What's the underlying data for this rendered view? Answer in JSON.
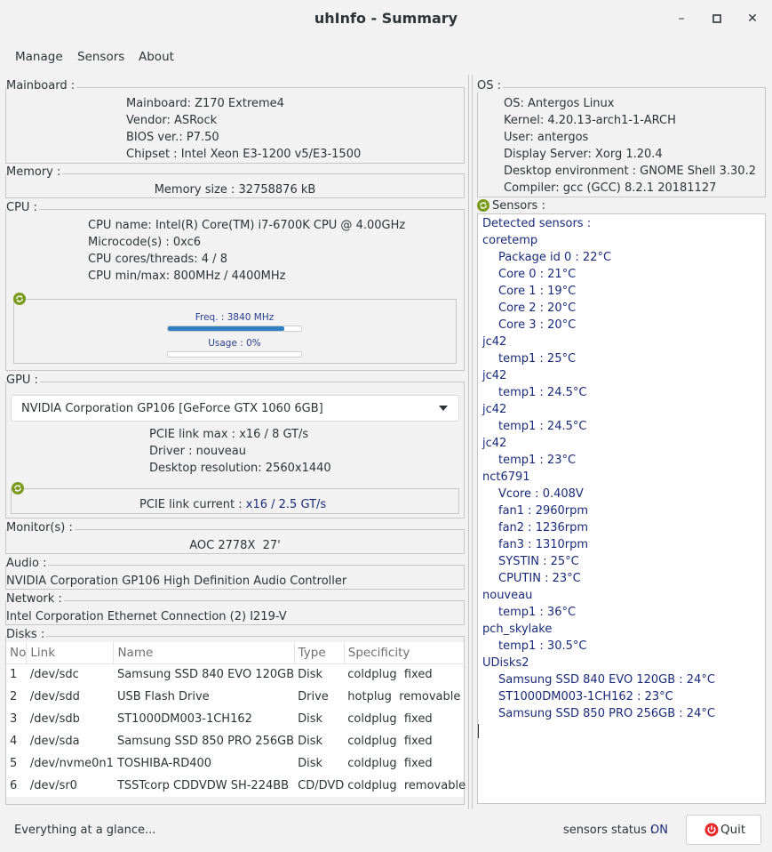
{
  "window": {
    "title": "uhInfo - Summary",
    "minimize_glyph": "–",
    "maximize_glyph": "□",
    "close_glyph": "✕"
  },
  "menu": [
    "Manage",
    "Sensors",
    "About"
  ],
  "mainboard": {
    "label": "Mainboard :",
    "lines": [
      "Mainboard: Z170 Extreme4",
      "Vendor: ASRock",
      "BIOS ver.: P7.50",
      "Chipset : Intel Xeon E3-1200 v5/E3-1500"
    ]
  },
  "memory": {
    "label": "Memory :",
    "size": "Memory size : 32758876 kB"
  },
  "cpu": {
    "label": "CPU :",
    "lines": [
      "CPU name: Intel(R) Core(TM) i7-6700K CPU @ 4.00GHz",
      "Microcode(s) : 0xc6",
      "CPU cores/threads: 4 / 8",
      "CPU min/max: 800MHz / 4400MHz"
    ],
    "freq_label": "Freq. : 3840 MHz",
    "freq_fraction": 0.8727,
    "usage_label": "Usage : 0%",
    "usage_fraction": 0
  },
  "gpu": {
    "label": "GPU :",
    "selected": "NVIDIA Corporation GP106 [GeForce GTX 1060 6GB]",
    "lines": [
      "PCIE link max : x16 / 8 GT/s",
      "Driver : nouveau",
      "Desktop resolution: 2560x1440"
    ],
    "link_current_label": "PCIE link current : ",
    "link_current_value": "x16 / 2.5 GT/s"
  },
  "monitors": {
    "label": "Monitor(s) :",
    "value": "AOC 2778X  27'"
  },
  "audio": {
    "label": "Audio :",
    "value": "NVIDIA Corporation GP106 High Definition Audio Controller"
  },
  "network": {
    "label": "Network :",
    "value": "Intel Corporation Ethernet Connection (2) I219-V"
  },
  "disks": {
    "label": "Disks :",
    "columns": [
      "No",
      "Link",
      "Name",
      "Type",
      "Specificity"
    ],
    "rows": [
      [
        "1",
        "/dev/sdc",
        "Samsung SSD 840 EVO 120GB",
        "Disk",
        "coldplug  fixed"
      ],
      [
        "2",
        "/dev/sdd",
        "USB Flash Drive",
        "Drive",
        "hotplug  removable"
      ],
      [
        "3",
        "/dev/sdb",
        "ST1000DM003-1CH162",
        "Disk",
        "coldplug  fixed"
      ],
      [
        "4",
        "/dev/sda",
        "Samsung SSD 850 PRO 256GB",
        "Disk",
        "coldplug  fixed"
      ],
      [
        "5",
        "/dev/nvme0n1",
        "TOSHIBA-RD400",
        "Disk",
        "coldplug  fixed"
      ],
      [
        "6",
        "/dev/sr0",
        "TSSTcorp CDDVDW SH-224BB",
        "CD/DVD",
        "coldplug  removable"
      ]
    ]
  },
  "os": {
    "label": "OS :",
    "lines": [
      "OS: Antergos Linux",
      "Kernel: 4.20.13-arch1-1-ARCH",
      "User: antergos",
      "Display Server: Xorg 1.20.4",
      "Desktop environment : GNOME Shell 3.30.2",
      "Compiler: gcc (GCC) 8.2.1 20181127"
    ]
  },
  "sensors": {
    "label": "Sensors :",
    "lines": [
      {
        "text": "Detected sensors :",
        "indent": 0
      },
      {
        "text": "coretemp",
        "indent": 0
      },
      {
        "text": "Package id 0 : 22°C",
        "indent": 1
      },
      {
        "text": "Core 0 : 21°C",
        "indent": 1
      },
      {
        "text": "Core 1 : 19°C",
        "indent": 1
      },
      {
        "text": "Core 2 : 20°C",
        "indent": 1
      },
      {
        "text": "Core 3 : 20°C",
        "indent": 1
      },
      {
        "text": "jc42",
        "indent": 0
      },
      {
        "text": "temp1 : 25°C",
        "indent": 1
      },
      {
        "text": "jc42",
        "indent": 0
      },
      {
        "text": "temp1 : 24.5°C",
        "indent": 1
      },
      {
        "text": "jc42",
        "indent": 0
      },
      {
        "text": "temp1 : 24.5°C",
        "indent": 1
      },
      {
        "text": "jc42",
        "indent": 0
      },
      {
        "text": "temp1 : 23°C",
        "indent": 1
      },
      {
        "text": "nct6791",
        "indent": 0
      },
      {
        "text": "Vcore : 0.408V",
        "indent": 1
      },
      {
        "text": "fan1 : 2960rpm",
        "indent": 1
      },
      {
        "text": "fan2 : 1236rpm",
        "indent": 1
      },
      {
        "text": "fan3 : 1310rpm",
        "indent": 1
      },
      {
        "text": "SYSTIN : 25°C",
        "indent": 1
      },
      {
        "text": "CPUTIN : 23°C",
        "indent": 1
      },
      {
        "text": "nouveau",
        "indent": 0
      },
      {
        "text": "temp1 : 36°C",
        "indent": 1
      },
      {
        "text": "pch_skylake",
        "indent": 0
      },
      {
        "text": "temp1 : 30.5°C",
        "indent": 1
      },
      {
        "text": "UDisks2",
        "indent": 0
      },
      {
        "text": "Samsung SSD 840 EVO 120GB : 24°C",
        "indent": 1
      },
      {
        "text": "ST1000DM003-1CH162 : 23°C",
        "indent": 1
      },
      {
        "text": "Samsung SSD 850 PRO 256GB : 24°C",
        "indent": 1
      }
    ]
  },
  "status": {
    "message": "Everything at a glance...",
    "sensors_label": "sensors status :",
    "sensors_value": "ON",
    "quit_label": "Quit"
  },
  "colors": {
    "accent_blue": "#1a2a7a",
    "progress_blue": "#2f80c2",
    "refresh_green": "#7a9a1c",
    "quit_red": "#e8282b"
  },
  "icons": {
    "refresh": "refresh-icon",
    "quit": "power-icon",
    "combo_arrow": "chevron-down-icon"
  }
}
